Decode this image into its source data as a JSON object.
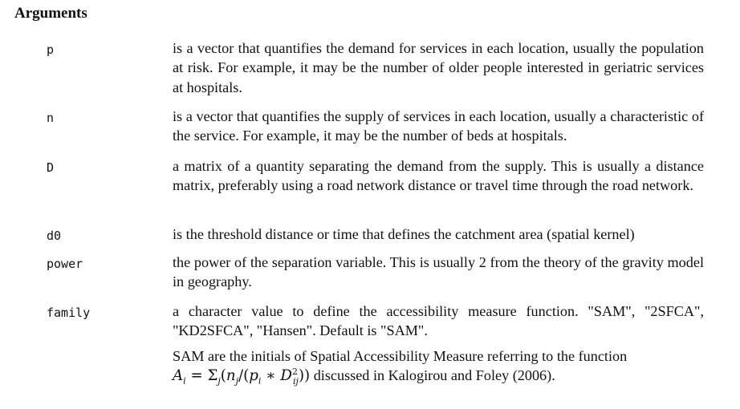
{
  "heading": "Arguments",
  "args": [
    {
      "name": "p",
      "desc": "is a vector that quantifies the demand for services in each location, usually the population at risk. For example, it may be the number of older people interested in geriatric services at hospitals."
    },
    {
      "name": "n",
      "desc": "is a vector that quantifies the supply of services in each location, usually a characteristic of the service. For example, it may be the number of beds at hospitals."
    },
    {
      "name": "D",
      "desc": "a matrix of a quantity separating the demand from the supply. This is usually a distance matrix, preferably using a road network distance or travel time through the road network."
    },
    {
      "name": "d0",
      "desc": "is the threshold distance or time that defines the catchment area (spatial kernel)"
    },
    {
      "name": "power",
      "desc": "the power of the separation variable. This is usually 2 from the theory of the gravity model in geography."
    },
    {
      "name": "family",
      "desc": "a character value to define the accessibility measure function. \"SAM\", \"2SFCA\", \"KD2SFCA\", \"Hansen\". Default is \"SAM\".",
      "note_before": "SAM are the initials of Spatial Accessibility Measure referring to the function",
      "note_after": "discussed in Kalogirou and Foley (2006)."
    }
  ]
}
